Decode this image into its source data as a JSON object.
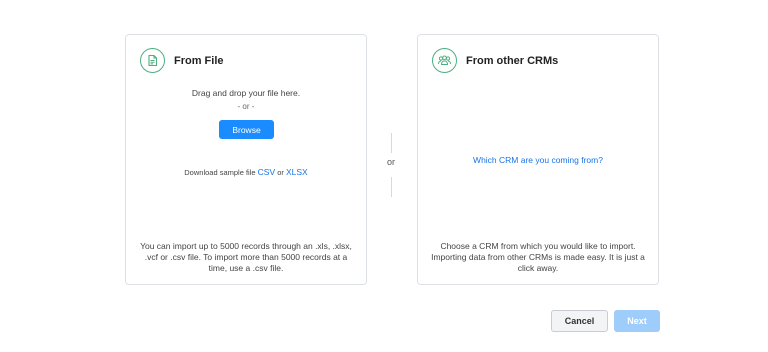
{
  "from_file": {
    "title": "From File",
    "drag_text": "Drag and drop your file here.",
    "or_text": "- or -",
    "browse_label": "Browse",
    "download_prefix": "Download sample file ",
    "csv_label": "CSV",
    "or_word": " or ",
    "xlsx_label": "XLSX",
    "description": "You can import up to 5000 records through an .xls, .xlsx, .vcf or .csv file. To import more than 5000 records at a time, use a .csv file.",
    "icon": "file-spreadsheet-icon"
  },
  "divider": {
    "or_text": "or"
  },
  "from_crm": {
    "title": "From other CRMs",
    "which_crm_link": "Which CRM are you coming from?",
    "description": "Choose a CRM from which you would like to import. Importing data from other CRMs is made easy. It is just a click away.",
    "icon": "users-group-icon"
  },
  "footer": {
    "cancel_label": "Cancel",
    "next_label": "Next"
  },
  "colors": {
    "accent": "#1a8cff",
    "icon_green": "#4caf7f",
    "link": "#1a73e8",
    "next_disabled": "#9fcdfb"
  }
}
